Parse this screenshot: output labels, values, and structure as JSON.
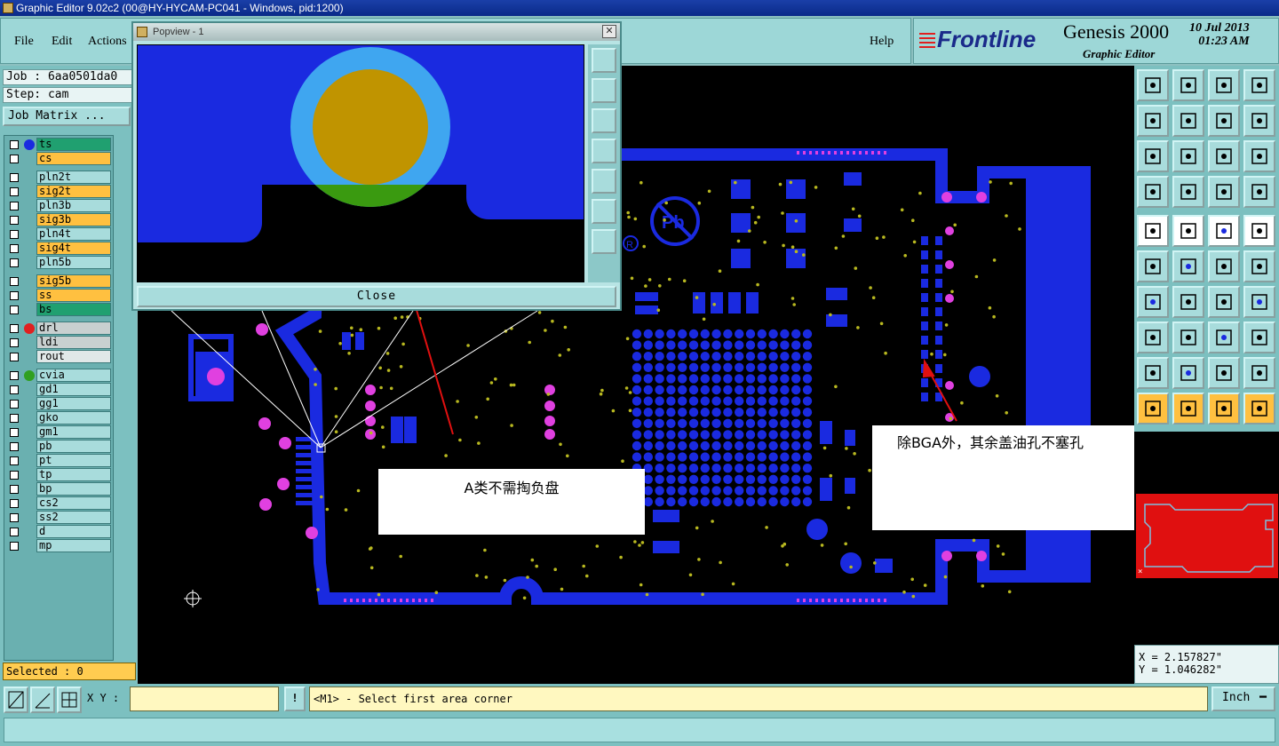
{
  "window": {
    "title": "Graphic Editor 9.02c2 (00@HY-HYCAM-PC041 - Windows, pid:1200)"
  },
  "menu": {
    "file": "File",
    "edit": "Edit",
    "actions": "Actions",
    "help": "Help"
  },
  "branding": {
    "logo": "Frontline",
    "product": "Genesis 2000",
    "subtitle": "Graphic Editor",
    "date": "10 Jul 2013",
    "time": "01:23 AM"
  },
  "job": {
    "job_line": "Job : 6aa0501da0",
    "step_line": "Step: cam",
    "matrix_button": "Job Matrix ..."
  },
  "layers": [
    {
      "name": "ts",
      "color": "#20a070",
      "dot": "#1a2ae0"
    },
    {
      "name": "cs",
      "color": "#ffc040",
      "dot": ""
    },
    {
      "name": "pln2t",
      "color": "#a8dcdc",
      "dot": ""
    },
    {
      "name": "sig2t",
      "color": "#ffc040",
      "dot": ""
    },
    {
      "name": "pln3b",
      "color": "#a8dcdc",
      "dot": ""
    },
    {
      "name": "sig3b",
      "color": "#ffc040",
      "dot": ""
    },
    {
      "name": "pln4t",
      "color": "#a8dcdc",
      "dot": ""
    },
    {
      "name": "sig4t",
      "color": "#ffc040",
      "dot": ""
    },
    {
      "name": "pln5b",
      "color": "#a8dcdc",
      "dot": ""
    },
    {
      "name": "sig5b",
      "color": "#ffc040",
      "dot": ""
    },
    {
      "name": "ss",
      "color": "#ffc040",
      "dot": ""
    },
    {
      "name": "bs",
      "color": "#20a070",
      "dot": ""
    },
    {
      "name": "drl",
      "color": "#c8d0d0",
      "dot": "#e02020"
    },
    {
      "name": "ldi",
      "color": "#c8d0d0",
      "dot": ""
    },
    {
      "name": "rout",
      "color": "#e0e8e8",
      "dot": ""
    },
    {
      "name": "cvia",
      "color": "#a8dcdc",
      "dot": "#30a020"
    },
    {
      "name": "gd1",
      "color": "#a8dcdc",
      "dot": ""
    },
    {
      "name": "gg1",
      "color": "#a8dcdc",
      "dot": ""
    },
    {
      "name": "gko",
      "color": "#a8dcdc",
      "dot": ""
    },
    {
      "name": "gm1",
      "color": "#a8dcdc",
      "dot": ""
    },
    {
      "name": "pb",
      "color": "#a8dcdc",
      "dot": ""
    },
    {
      "name": "pt",
      "color": "#a8dcdc",
      "dot": ""
    },
    {
      "name": "tp",
      "color": "#a8dcdc",
      "dot": ""
    },
    {
      "name": "bp",
      "color": "#a8dcdc",
      "dot": ""
    },
    {
      "name": "cs2",
      "color": "#a8dcdc",
      "dot": ""
    },
    {
      "name": "ss2",
      "color": "#a8dcdc",
      "dot": ""
    },
    {
      "name": "d",
      "color": "#a8dcdc",
      "dot": ""
    },
    {
      "name": "mp",
      "color": "#a8dcdc",
      "dot": ""
    }
  ],
  "selection": {
    "text": "Selected : 0"
  },
  "popview": {
    "title": "Popview - 1",
    "close_label": "Close"
  },
  "annotations": {
    "note_a": "A类不需掏负盘",
    "note_b": "除BGA外，其余盖油孔不塞孔"
  },
  "coords": {
    "x": "X = 2.157827\"",
    "y": "Y = 1.046282\""
  },
  "bottom": {
    "xy_label": "X Y :",
    "xy_value": "",
    "exclaim": "!",
    "status": "<M1> - Select first area corner",
    "unit": "Inch"
  },
  "colors": {
    "board": "#1a2ae0",
    "pad_magenta": "#e040e0",
    "via_yellow": "#b8b820",
    "arrow": "#e01010",
    "menu_bg": "#9dd7d7"
  }
}
